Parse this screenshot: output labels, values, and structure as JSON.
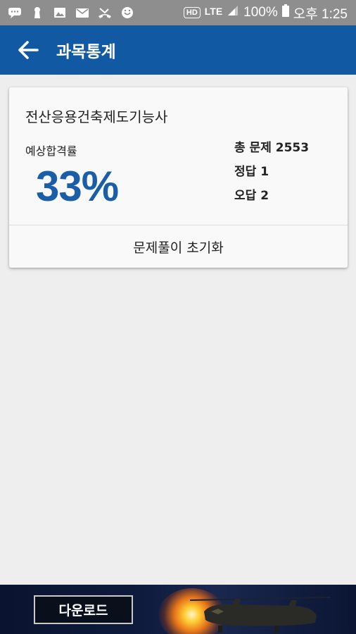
{
  "status_bar": {
    "icons": [
      "chat-icon",
      "keyhole-icon",
      "image-icon",
      "mail-icon",
      "missed-call-icon",
      "app-icon",
      "hd-icon",
      "lte-icon",
      "signal-icon",
      "battery-icon"
    ],
    "hd": "HD",
    "lte": "LTE",
    "battery": "100%",
    "time": "오후 1:25"
  },
  "app_bar": {
    "title": "과목통계",
    "color": "#1259a4"
  },
  "card": {
    "subject": "전산응용건축제도기능사",
    "rate_label": "예상합격률",
    "rate_value": "33%",
    "total": "총 문제 2553",
    "correct": "정답 1",
    "wrong": "오답 2",
    "reset_label": "문제풀이 초기화",
    "accent": "#1a5ea8"
  },
  "ad": {
    "button_label": "다운로드"
  }
}
